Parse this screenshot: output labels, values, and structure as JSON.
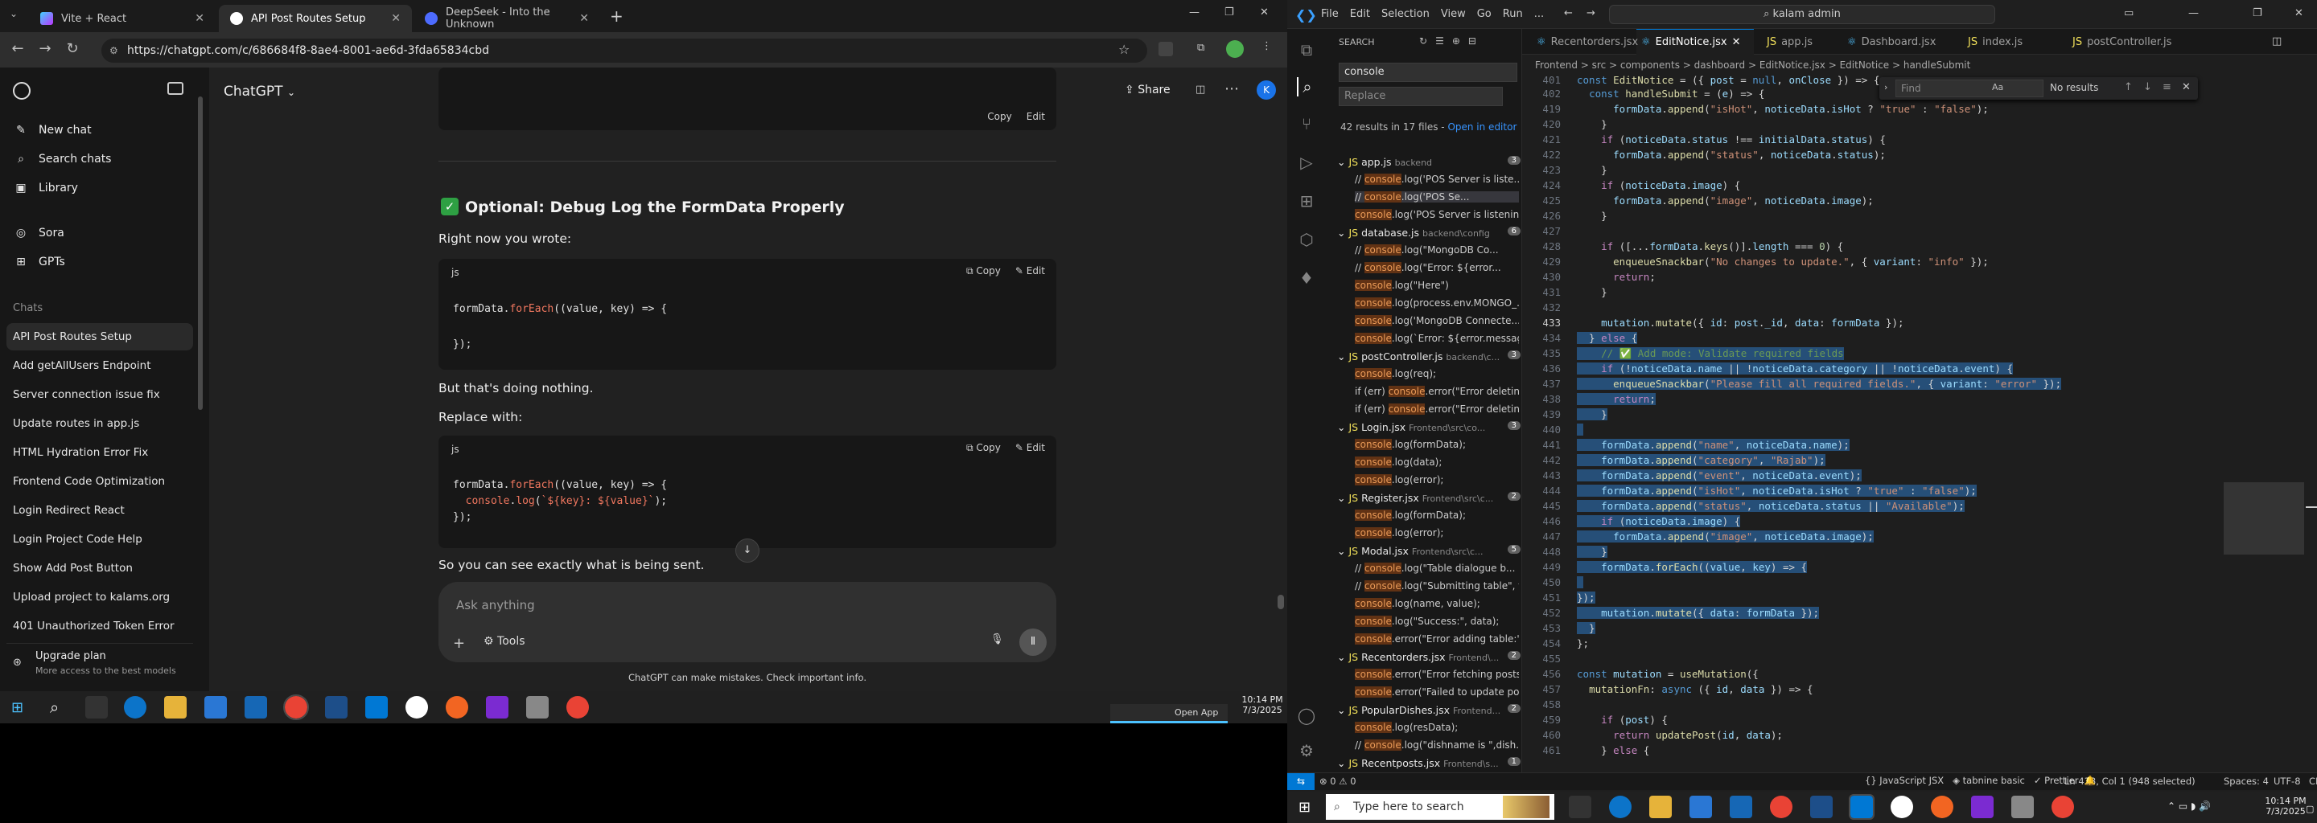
{
  "browser": {
    "tabs": [
      {
        "label": "Vite + React",
        "color": "#bd34fe"
      },
      {
        "label": "API Post Routes Setup",
        "color": "#ffffff"
      },
      {
        "label": "DeepSeek - Into the Unknown",
        "color": "#4d6bfe"
      }
    ],
    "url": "https://chatgpt.com/c/686684f8-8ae4-8001-ae6d-3fda65834cbd"
  },
  "sidebar": {
    "new_chat": "New chat",
    "search": "Search chats",
    "library": "Library",
    "sora": "Sora",
    "gpts": "GPTs",
    "section": "Chats",
    "chats": [
      "API Post Routes Setup",
      "Add getAllUsers Endpoint",
      "Server connection issue fix",
      "Update routes in app.js",
      "HTML Hydration Error Fix",
      "Frontend Code Optimization",
      "Login Redirect React",
      "Login Project Code Help",
      "Show Add Post Button",
      "Upload project to kalams.org",
      "401 Unauthorized Token Error"
    ],
    "upgrade_title": "Upgrade plan",
    "upgrade_sub": "More access to the best models"
  },
  "chatgpt": {
    "model": "ChatGPT",
    "share": "Share",
    "heading": "Optional: Debug Log the FormData Properly",
    "p1": "Right now you wrote:",
    "p2": "But that's doing nothing.",
    "p3": "Replace with:",
    "p4": "So you can see exactly what is being sent.",
    "lang": "js",
    "copy": "Copy",
    "edit": "Edit",
    "input_placeholder": "Ask anything",
    "tools": "Tools",
    "disclaimer": "ChatGPT can make mistakes. Check important info."
  },
  "taskbar_left": {
    "time": "10:14 PM",
    "date": "7/3/2025",
    "open_app": "Open App"
  },
  "vscode": {
    "menu": [
      "File",
      "Edit",
      "Selection",
      "View",
      "Go",
      "Run",
      "..."
    ],
    "search_box": "kalam admin",
    "search": {
      "title": "SEARCH",
      "query": "console",
      "replace": "Replace",
      "summary": "42 results in 17 files - ",
      "open_in_editor": "Open in editor"
    },
    "results": [
      {
        "type": "file",
        "name": "app.js",
        "path": "backend",
        "count": "3"
      },
      {
        "type": "hit",
        "text": "// console.log('POS Server is liste..."
      },
      {
        "type": "hit",
        "text": "// console.log('POS Se..."
      },
      {
        "type": "hit",
        "text": "console.log('POS Server is listenin..."
      },
      {
        "type": "file",
        "name": "database.js",
        "path": "backend\\config",
        "count": "6"
      },
      {
        "type": "hit",
        "text": "// console.log(\"MongoDB Co..."
      },
      {
        "type": "hit",
        "text": "// console.log(\"Error: ${error..."
      },
      {
        "type": "hit",
        "text": "console.log(\"Here\")"
      },
      {
        "type": "hit",
        "text": "console.log(process.env.MONGO_..."
      },
      {
        "type": "hit",
        "text": "console.log('MongoDB Connecte..."
      },
      {
        "type": "hit",
        "text": "console.log(`Error: ${error.messag..."
      },
      {
        "type": "file",
        "name": "postController.js",
        "path": "backend\\c...",
        "count": "3"
      },
      {
        "type": "hit",
        "text": "console.log(req);"
      },
      {
        "type": "hit",
        "text": "if (err) console.error(\"Error deletin..."
      },
      {
        "type": "hit",
        "text": "if (err) console.error(\"Error deletin..."
      },
      {
        "type": "file",
        "name": "Login.jsx",
        "path": "Frontend\\src\\co...",
        "count": "3"
      },
      {
        "type": "hit",
        "text": "console.log(formData);"
      },
      {
        "type": "hit",
        "text": "console.log(data);"
      },
      {
        "type": "hit",
        "text": "console.log(error);"
      },
      {
        "type": "file",
        "name": "Register.jsx",
        "path": "Frontend\\src\\c...",
        "count": "2"
      },
      {
        "type": "hit",
        "text": "console.log(formData);"
      },
      {
        "type": "hit",
        "text": "console.log(error);"
      },
      {
        "type": "file",
        "name": "Modal.jsx",
        "path": "Frontend\\src\\c...",
        "count": "5"
      },
      {
        "type": "hit",
        "text": "// console.log(\"Table dialogue b..."
      },
      {
        "type": "hit",
        "text": "// console.log(\"Submitting table\", ta..."
      },
      {
        "type": "hit",
        "text": "console.log(name, value);"
      },
      {
        "type": "hit",
        "text": "console.log(\"Success:\", data);"
      },
      {
        "type": "hit",
        "text": "console.error(\"Error adding table:\"..."
      },
      {
        "type": "file",
        "name": "Recentorders.jsx",
        "path": "Frontend\\...",
        "count": "2"
      },
      {
        "type": "hit",
        "text": "console.error(\"Error fetching posts..."
      },
      {
        "type": "hit",
        "text": "console.error(\"Failed to update po..."
      },
      {
        "type": "file",
        "name": "PopularDishes.jsx",
        "path": "Frontend...",
        "count": "2"
      },
      {
        "type": "hit",
        "text": "console.log(resData);"
      },
      {
        "type": "hit",
        "text": "// console.log(\"dishname is \",dish..."
      },
      {
        "type": "file",
        "name": "Recentposts.jsx",
        "path": "Frontend\\s...",
        "count": "1"
      }
    ],
    "tabs": [
      "Recentorders.jsx",
      "EditNotice.jsx",
      "app.js",
      "Dashboard.jsx",
      "index.js",
      "postController.js"
    ],
    "breadcrumb": "Frontend > src > components > dashboard > EditNotice.jsx > EditNotice > handleSubmit",
    "find": {
      "placeholder": "Find",
      "result": "No results"
    },
    "status": {
      "errors": "0",
      "warnings": "0",
      "position": "Ln 433, Col 1 (948 selected)",
      "spaces": "Spaces: 4",
      "encoding": "UTF-8",
      "eol": "CRLF",
      "lang": "JavaScript JSX",
      "tabnine": "tabnine basic",
      "prettier": "Prettier"
    }
  },
  "taskbar_right": {
    "search_placeholder": "Type here to search",
    "time": "10:14 PM",
    "date": "7/3/2025"
  }
}
